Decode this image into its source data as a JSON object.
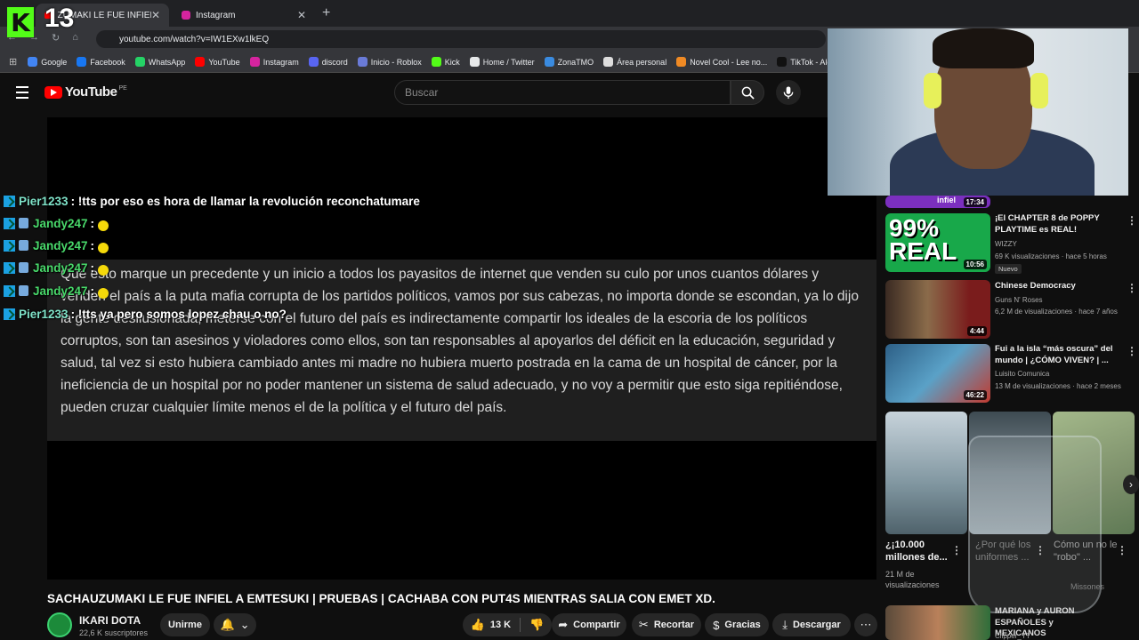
{
  "browser": {
    "tabs": [
      {
        "label": "ZUMAKI LE FUE INFIEL",
        "icon": "youtube-icon"
      },
      {
        "label": "Instagram",
        "icon": "instagram-icon"
      }
    ],
    "url": "youtube.com/watch?v=IW1EXw1lkEQ",
    "bookmarks": [
      {
        "label": "Google",
        "color": "#4285f4"
      },
      {
        "label": "Facebook",
        "color": "#1877f2"
      },
      {
        "label": "WhatsApp",
        "color": "#25d366"
      },
      {
        "label": "YouTube",
        "color": "#ff0000"
      },
      {
        "label": "Instagram",
        "color": "#d6249f"
      },
      {
        "label": "discord",
        "color": "#5865f2"
      },
      {
        "label": "Inicio - Roblox",
        "color": "#6a7bd8"
      },
      {
        "label": "Kick",
        "color": "#53fc18"
      },
      {
        "label": "Home / Twitter",
        "color": "#e7e9ea"
      },
      {
        "label": "ZonaTMO",
        "color": "#3a8be0"
      },
      {
        "label": "Área personal",
        "color": "#dddddd"
      },
      {
        "label": "Novel Cool - Lee no...",
        "color": "#f08a24"
      },
      {
        "label": "TikTok - Alegra tu",
        "color": "#111111"
      }
    ]
  },
  "overlay": {
    "kick_count": "13",
    "chat": [
      {
        "user": "Pier1233",
        "color": "#7fe3c9",
        "message": ": !tts por eso es hora de llamar la revolución reconchatumare",
        "emote": false
      },
      {
        "user": "Jandy247",
        "color": "#49d96b",
        "message": ":",
        "emote": true
      },
      {
        "user": "Jandy247",
        "color": "#49d96b",
        "message": ":",
        "emote": true
      },
      {
        "user": "Jandy247",
        "color": "#49d96b",
        "message": ":",
        "emote": true
      },
      {
        "user": "Jandy247",
        "color": "#49d96b",
        "message": ":",
        "emote": true
      },
      {
        "user": "Pier1233",
        "color": "#7fe3c9",
        "message": ": !tts ya pero somos lopez chau o no?",
        "emote": false
      }
    ]
  },
  "youtube": {
    "logo_text": "YouTube",
    "country_code": "PE",
    "search_placeholder": "Buscar",
    "video_text": "Que esto marque un precedente y un inicio a todos los payasitos de internet que venden su culo por unos cuantos dólares y venden el país a la puta mafia corrupta de los partidos políticos, vamos por sus cabezas, no importa donde se escondan, ya lo dijo la gente desilusionada, meterse con el futuro del país es indirectamente compartir los ideales de la escoria de los políticos corruptos, son tan asesinos y violadores como ellos, son tan responsables al apoyarlos del déficit en la educación, seguridad y salud, tal vez si esto hubiera cambiado antes mi madre no hubiera muerto postrada en la cama de un hospital de cáncer, por la ineficiencia de un hospital por no poder mantener un sistema de salud adecuado, y no voy a permitir que esto siga repitiéndose, pueden cruzar cualquier límite menos el de la política y el futuro del país.",
    "video_title": "SACHAUZUMAKI LE FUE INFIEL A EMTESUKI | PRUEBAS | CACHABA CON PUT4S MIENTRAS SALIA CON EMET XD.",
    "channel": {
      "name": "IKARI DOTA",
      "subscribers": "22,6 K suscriptores"
    },
    "actions": {
      "join": "Unirme",
      "likes": "13 K",
      "share": "Compartir",
      "clip": "Recortar",
      "thanks": "Gracias",
      "download": "Descargar"
    },
    "sidebar": [
      {
        "title": "¡El CHAPTER 8 de POPPY PLAYTIME es REAL!",
        "channel": "WIZZY",
        "meta": "69 K visualizaciones · hace 5 horas",
        "duration": "10:56",
        "badge": "Nuevo",
        "thumb_color": "#18a84a"
      },
      {
        "title": "Chinese Democracy",
        "channel": "Guns N' Roses",
        "meta": "6,2 M de visualizaciones · hace 7 años",
        "duration": "4:44",
        "thumb_color": "#7a1c1c"
      },
      {
        "title": "Fui a la isla “más oscura” del mundo | ¿CÓMO VIVEN? | ...",
        "channel": "Luisito Comunica",
        "meta": "13 M de visualizaciones · hace 2 meses",
        "duration": "46:22",
        "thumb_color": "#2d5f86"
      }
    ],
    "partial_top": {
      "label": "infiel",
      "duration": "17:34"
    },
    "shorts": [
      {
        "title": "¿¡10.000 millones de...",
        "meta": "21 M de visualizaciones",
        "thumb_color": "#8aa4b5"
      },
      {
        "title": "¿Por qué los uniformes ...",
        "meta": "",
        "thumb_color": "#6b7c86"
      },
      {
        "title": "Cómo un no le \"robo\" ...",
        "meta": "Missones",
        "thumb_color": "#7c8f6a"
      }
    ],
    "bottom_item": {
      "title": "MARIANA y AURON ESPAÑOLES y MEXICANOS",
      "channel": "Clipper_YT"
    }
  }
}
